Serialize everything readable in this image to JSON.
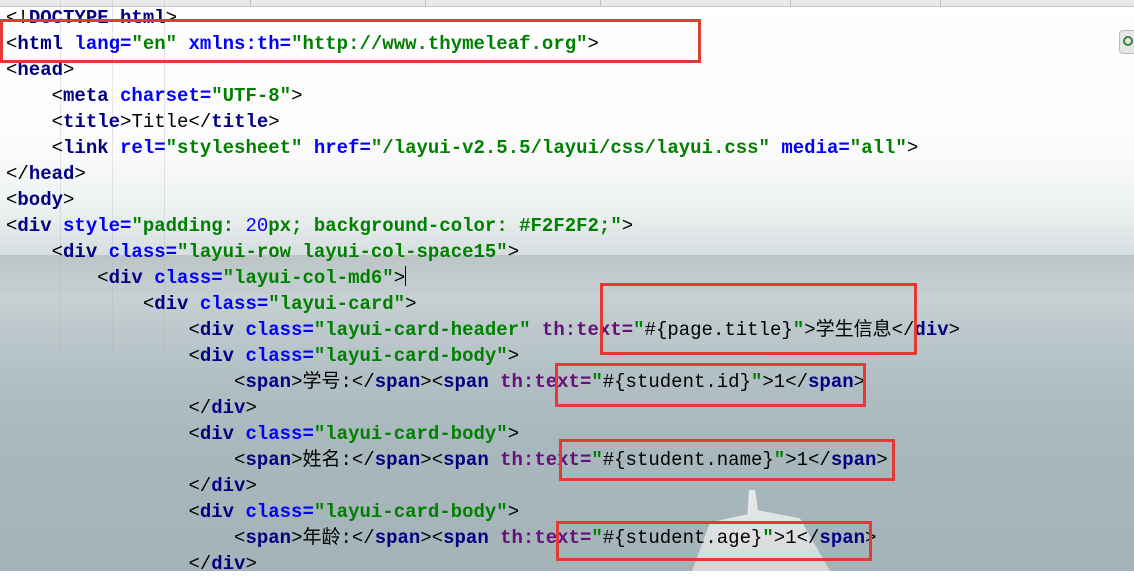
{
  "editor": {
    "lines": [
      {
        "indent": 0,
        "tokens": [
          [
            "p",
            "<!"
          ],
          [
            "tag",
            "DOCTYPE html"
          ],
          [
            "p",
            ">"
          ]
        ]
      },
      {
        "indent": 0,
        "tokens": [
          [
            "p",
            "<"
          ],
          [
            "tag",
            "html "
          ],
          [
            "attr",
            "lang="
          ],
          [
            "str",
            "\"en\""
          ],
          [
            "p",
            " "
          ],
          [
            "attr",
            "xmlns:th="
          ],
          [
            "str",
            "\"http://www.thymeleaf.org\""
          ],
          [
            "p",
            ">"
          ]
        ]
      },
      {
        "indent": 0,
        "tokens": [
          [
            "p",
            "<"
          ],
          [
            "tag",
            "head"
          ],
          [
            "p",
            ">"
          ]
        ]
      },
      {
        "indent": 1,
        "tokens": [
          [
            "p",
            "<"
          ],
          [
            "tag",
            "meta "
          ],
          [
            "attr",
            "charset="
          ],
          [
            "str",
            "\"UTF-8\""
          ],
          [
            "p",
            ">"
          ]
        ]
      },
      {
        "indent": 1,
        "tokens": [
          [
            "p",
            "<"
          ],
          [
            "tag",
            "title"
          ],
          [
            "p",
            ">"
          ],
          [
            "txt",
            "Title"
          ],
          [
            "p",
            "</"
          ],
          [
            "tag",
            "title"
          ],
          [
            "p",
            ">"
          ]
        ]
      },
      {
        "indent": 1,
        "tokens": [
          [
            "p",
            "<"
          ],
          [
            "tag",
            "link "
          ],
          [
            "attr",
            "rel="
          ],
          [
            "str",
            "\"stylesheet\""
          ],
          [
            "p",
            " "
          ],
          [
            "attr",
            "href="
          ],
          [
            "str",
            "\"/layui-v2.5.5/layui/css/layui.css\""
          ],
          [
            "p",
            " "
          ],
          [
            "attr",
            "media="
          ],
          [
            "str",
            "\"all\""
          ],
          [
            "p",
            ">"
          ]
        ]
      },
      {
        "indent": 0,
        "tokens": [
          [
            "p",
            "</"
          ],
          [
            "tag",
            "head"
          ],
          [
            "p",
            ">"
          ]
        ]
      },
      {
        "indent": 0,
        "tokens": [
          [
            "p",
            "<"
          ],
          [
            "tag",
            "body"
          ],
          [
            "p",
            ">"
          ]
        ]
      },
      {
        "indent": 0,
        "tokens": [
          [
            "p",
            "<"
          ],
          [
            "tag",
            "div "
          ],
          [
            "attr",
            "style="
          ],
          [
            "str",
            "\"padding: "
          ],
          [
            "num",
            "20"
          ],
          [
            "str",
            "px; background-color: #F2F2F2;\""
          ],
          [
            "p",
            ">"
          ]
        ]
      },
      {
        "indent": 1,
        "tokens": [
          [
            "p",
            "<"
          ],
          [
            "tag",
            "div "
          ],
          [
            "attr",
            "class="
          ],
          [
            "str",
            "\"layui-row layui-col-space15\""
          ],
          [
            "p",
            ">"
          ]
        ]
      },
      {
        "indent": 2,
        "tokens": [
          [
            "p",
            "<"
          ],
          [
            "tag",
            "div "
          ],
          [
            "attr",
            "class="
          ],
          [
            "str",
            "\"layui-col-md6\""
          ],
          [
            "p",
            ">"
          ],
          [
            "caret",
            ""
          ]
        ]
      },
      {
        "indent": 3,
        "tokens": [
          [
            "p",
            "<"
          ],
          [
            "tag",
            "div "
          ],
          [
            "attr",
            "class="
          ],
          [
            "str",
            "\"layui-card\""
          ],
          [
            "p",
            ">"
          ]
        ]
      },
      {
        "indent": 4,
        "tokens": [
          [
            "p",
            "<"
          ],
          [
            "tag",
            "div "
          ],
          [
            "attr",
            "class="
          ],
          [
            "str",
            "\"layui-card-header\""
          ],
          [
            "p",
            " "
          ],
          [
            "th",
            "th:text="
          ],
          [
            "str",
            "\""
          ],
          [
            "expr",
            "#{page.title}"
          ],
          [
            "str",
            "\""
          ],
          [
            "p",
            ">"
          ],
          [
            "txt",
            "学生信息"
          ],
          [
            "p",
            "</"
          ],
          [
            "tag",
            "div"
          ],
          [
            "p",
            ">"
          ]
        ]
      },
      {
        "indent": 4,
        "tokens": [
          [
            "p",
            "<"
          ],
          [
            "tag",
            "div "
          ],
          [
            "attr",
            "class="
          ],
          [
            "str",
            "\"layui-card-body\""
          ],
          [
            "p",
            ">"
          ]
        ]
      },
      {
        "indent": 5,
        "tokens": [
          [
            "p",
            "<"
          ],
          [
            "tag",
            "span"
          ],
          [
            "p",
            ">"
          ],
          [
            "txt",
            "学号:"
          ],
          [
            "p",
            "</"
          ],
          [
            "tag",
            "span"
          ],
          [
            "p",
            "><"
          ],
          [
            "tag",
            "span "
          ],
          [
            "th",
            "th:text="
          ],
          [
            "str",
            "\""
          ],
          [
            "expr",
            "#{student.id}"
          ],
          [
            "str",
            "\""
          ],
          [
            "p",
            ">"
          ],
          [
            "txt",
            "1"
          ],
          [
            "p",
            "</"
          ],
          [
            "tag",
            "span"
          ],
          [
            "p",
            ">"
          ]
        ]
      },
      {
        "indent": 4,
        "tokens": [
          [
            "p",
            "</"
          ],
          [
            "tag",
            "div"
          ],
          [
            "p",
            ">"
          ]
        ]
      },
      {
        "indent": 4,
        "tokens": [
          [
            "p",
            "<"
          ],
          [
            "tag",
            "div "
          ],
          [
            "attr",
            "class="
          ],
          [
            "str",
            "\"layui-card-body\""
          ],
          [
            "p",
            ">"
          ]
        ]
      },
      {
        "indent": 5,
        "tokens": [
          [
            "p",
            "<"
          ],
          [
            "tag",
            "span"
          ],
          [
            "p",
            ">"
          ],
          [
            "txt",
            "姓名:"
          ],
          [
            "p",
            "</"
          ],
          [
            "tag",
            "span"
          ],
          [
            "p",
            "><"
          ],
          [
            "tag",
            "span "
          ],
          [
            "th",
            "th:text="
          ],
          [
            "str",
            "\""
          ],
          [
            "expr",
            "#{student.name}"
          ],
          [
            "str",
            "\""
          ],
          [
            "p",
            ">"
          ],
          [
            "txt",
            "1"
          ],
          [
            "p",
            "</"
          ],
          [
            "tag",
            "span"
          ],
          [
            "p",
            ">"
          ]
        ]
      },
      {
        "indent": 4,
        "tokens": [
          [
            "p",
            "</"
          ],
          [
            "tag",
            "div"
          ],
          [
            "p",
            ">"
          ]
        ]
      },
      {
        "indent": 4,
        "tokens": [
          [
            "p",
            "<"
          ],
          [
            "tag",
            "div "
          ],
          [
            "attr",
            "class="
          ],
          [
            "str",
            "\"layui-card-body\""
          ],
          [
            "p",
            ">"
          ]
        ]
      },
      {
        "indent": 5,
        "tokens": [
          [
            "p",
            "<"
          ],
          [
            "tag",
            "span"
          ],
          [
            "p",
            ">"
          ],
          [
            "txt",
            "年龄:"
          ],
          [
            "p",
            "</"
          ],
          [
            "tag",
            "span"
          ],
          [
            "p",
            "><"
          ],
          [
            "tag",
            "span "
          ],
          [
            "th",
            "th:text="
          ],
          [
            "str",
            "\""
          ],
          [
            "expr",
            "#{student.age}"
          ],
          [
            "str",
            "\""
          ],
          [
            "p",
            ">"
          ],
          [
            "txt",
            "1"
          ],
          [
            "p",
            "</"
          ],
          [
            "tag",
            "span"
          ],
          [
            "p",
            ">"
          ]
        ]
      },
      {
        "indent": 4,
        "tokens": [
          [
            "p",
            "</"
          ],
          [
            "tag",
            "div"
          ],
          [
            "p",
            ">"
          ]
        ]
      }
    ]
  },
  "annotations": [
    {
      "name": "highlight-box-html-tag"
    },
    {
      "name": "highlight-box-page-title"
    },
    {
      "name": "highlight-box-student-id"
    },
    {
      "name": "highlight-box-student-name"
    },
    {
      "name": "highlight-box-student-age"
    }
  ],
  "colors": {
    "tag": "#000080",
    "attribute": "#0000ff",
    "thymeleaf_attribute": "#660e7a",
    "string": "#008000",
    "highlight_box": "#e53935"
  }
}
